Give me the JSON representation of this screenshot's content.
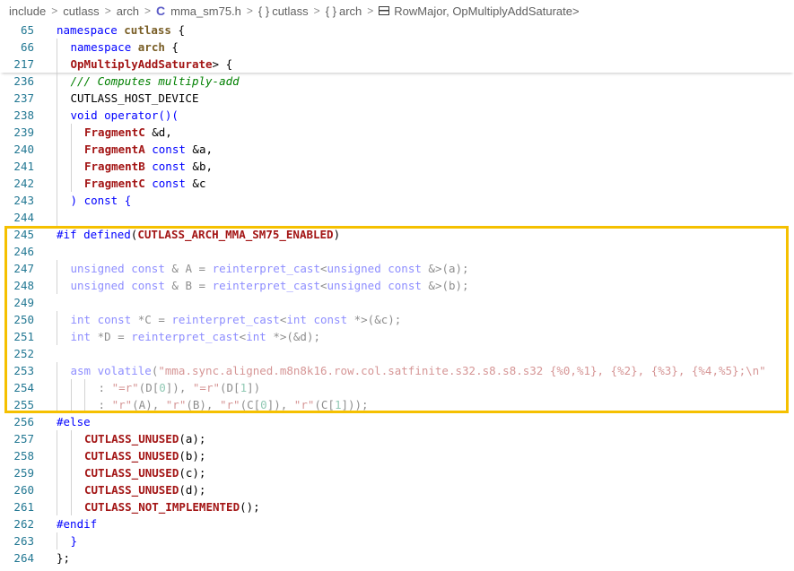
{
  "breadcrumb": {
    "items": [
      "include",
      "cutlass",
      "arch",
      "mma_sm75.h",
      "cutlass",
      "arch",
      "RowMajor, OpMultiplyAddSaturate>"
    ],
    "separator": ">"
  },
  "colors": {
    "highlight_border": "#f5c000",
    "line_number": "#237893",
    "keyword": "#0000ff",
    "macro": "#a31515"
  },
  "sticky_lines": [
    {
      "num": "65",
      "tokens": [
        {
          "t": "namespace ",
          "c": "kw"
        },
        {
          "t": "cutlass",
          "c": "cls"
        },
        {
          "t": " {",
          "c": "plain"
        }
      ],
      "indent": 0
    },
    {
      "num": "66",
      "tokens": [
        {
          "t": "namespace ",
          "c": "kw"
        },
        {
          "t": "arch",
          "c": "cls"
        },
        {
          "t": " {",
          "c": "plain"
        }
      ],
      "indent": 1
    },
    {
      "num": "217",
      "tokens": [
        {
          "t": "OpMultiplyAddSaturate",
          "c": "macro"
        },
        {
          "t": "> {",
          "c": "plain"
        }
      ],
      "indent": 1
    }
  ],
  "lines": [
    {
      "num": "236",
      "indent": 1,
      "tokens": [
        {
          "t": "/// Computes multiply-add",
          "c": "com"
        }
      ]
    },
    {
      "num": "237",
      "indent": 1,
      "tokens": [
        {
          "t": "CUTLASS_HOST_DEVICE",
          "c": "plain"
        }
      ]
    },
    {
      "num": "238",
      "indent": 1,
      "tokens": [
        {
          "t": "void ",
          "c": "kw"
        },
        {
          "t": "operator",
          "c": "kw"
        },
        {
          "t": "()(",
          "c": "kw"
        }
      ]
    },
    {
      "num": "239",
      "indent": 2,
      "tokens": [
        {
          "t": "FragmentC",
          "c": "macro"
        },
        {
          "t": " &d,",
          "c": "plain"
        }
      ]
    },
    {
      "num": "240",
      "indent": 2,
      "tokens": [
        {
          "t": "FragmentA",
          "c": "macro"
        },
        {
          "t": " const",
          "c": "kw"
        },
        {
          "t": " &a,",
          "c": "plain"
        }
      ]
    },
    {
      "num": "241",
      "indent": 2,
      "tokens": [
        {
          "t": "FragmentB",
          "c": "macro"
        },
        {
          "t": " const",
          "c": "kw"
        },
        {
          "t": " &b,",
          "c": "plain"
        }
      ]
    },
    {
      "num": "242",
      "indent": 2,
      "tokens": [
        {
          "t": "FragmentC",
          "c": "macro"
        },
        {
          "t": " const",
          "c": "kw"
        },
        {
          "t": " &c",
          "c": "plain"
        }
      ]
    },
    {
      "num": "243",
      "indent": 1,
      "tokens": [
        {
          "t": ") ",
          "c": "kw"
        },
        {
          "t": "const",
          "c": "kw"
        },
        {
          "t": " {",
          "c": "kw"
        }
      ]
    },
    {
      "num": "244",
      "indent": 1,
      "tokens": []
    },
    {
      "num": "245",
      "indent": 0,
      "tokens": [
        {
          "t": "#if ",
          "c": "pre"
        },
        {
          "t": "defined",
          "c": "pre"
        },
        {
          "t": "(",
          "c": "plain"
        },
        {
          "t": "CUTLASS_ARCH_MMA_SM75_ENABLED",
          "c": "macro"
        },
        {
          "t": ")",
          "c": "plain"
        }
      ]
    },
    {
      "num": "246",
      "indent": 0,
      "tokens": []
    },
    {
      "num": "247",
      "indent": 1,
      "dim": true,
      "tokens": [
        {
          "t": "unsigned ",
          "c": "kw"
        },
        {
          "t": "const",
          "c": "kw"
        },
        {
          "t": " & A = ",
          "c": "plain"
        },
        {
          "t": "reinterpret_cast",
          "c": "kw"
        },
        {
          "t": "<",
          "c": "plain"
        },
        {
          "t": "unsigned ",
          "c": "kw"
        },
        {
          "t": "const",
          "c": "kw"
        },
        {
          "t": " &>(a);",
          "c": "plain"
        }
      ]
    },
    {
      "num": "248",
      "indent": 1,
      "dim": true,
      "tokens": [
        {
          "t": "unsigned ",
          "c": "kw"
        },
        {
          "t": "const",
          "c": "kw"
        },
        {
          "t": " & B = ",
          "c": "plain"
        },
        {
          "t": "reinterpret_cast",
          "c": "kw"
        },
        {
          "t": "<",
          "c": "plain"
        },
        {
          "t": "unsigned ",
          "c": "kw"
        },
        {
          "t": "const",
          "c": "kw"
        },
        {
          "t": " &>(b);",
          "c": "plain"
        }
      ]
    },
    {
      "num": "249",
      "indent": 0,
      "tokens": []
    },
    {
      "num": "250",
      "indent": 1,
      "dim": true,
      "tokens": [
        {
          "t": "int ",
          "c": "kw"
        },
        {
          "t": "const",
          "c": "kw"
        },
        {
          "t": " *C = ",
          "c": "plain"
        },
        {
          "t": "reinterpret_cast",
          "c": "kw"
        },
        {
          "t": "<",
          "c": "plain"
        },
        {
          "t": "int ",
          "c": "kw"
        },
        {
          "t": "const",
          "c": "kw"
        },
        {
          "t": " *>(&c);",
          "c": "plain"
        }
      ]
    },
    {
      "num": "251",
      "indent": 1,
      "dim": true,
      "tokens": [
        {
          "t": "int ",
          "c": "kw"
        },
        {
          "t": "*D = ",
          "c": "plain"
        },
        {
          "t": "reinterpret_cast",
          "c": "kw"
        },
        {
          "t": "<",
          "c": "plain"
        },
        {
          "t": "int ",
          "c": "kw"
        },
        {
          "t": "*>(&d);",
          "c": "plain"
        }
      ]
    },
    {
      "num": "252",
      "indent": 0,
      "tokens": []
    },
    {
      "num": "253",
      "indent": 1,
      "dim": true,
      "tokens": [
        {
          "t": "asm ",
          "c": "kw"
        },
        {
          "t": "volatile",
          "c": "kw"
        },
        {
          "t": "(",
          "c": "plain"
        },
        {
          "t": "\"mma.sync.aligned.m8n8k16.row.col.satfinite.s32.s8.s8.s32 {%0,%1}, {%2}, {%3}, {%4,%5};\\n\"",
          "c": "str"
        }
      ]
    },
    {
      "num": "254",
      "indent": 3,
      "dim": true,
      "tokens": [
        {
          "t": ": ",
          "c": "plain"
        },
        {
          "t": "\"=r\"",
          "c": "str"
        },
        {
          "t": "(D[",
          "c": "plain"
        },
        {
          "t": "0",
          "c": "num"
        },
        {
          "t": "]), ",
          "c": "plain"
        },
        {
          "t": "\"=r\"",
          "c": "str"
        },
        {
          "t": "(D[",
          "c": "plain"
        },
        {
          "t": "1",
          "c": "num"
        },
        {
          "t": "])",
          "c": "plain"
        }
      ]
    },
    {
      "num": "255",
      "indent": 3,
      "dim": true,
      "tokens": [
        {
          "t": ": ",
          "c": "plain"
        },
        {
          "t": "\"r\"",
          "c": "str"
        },
        {
          "t": "(A), ",
          "c": "plain"
        },
        {
          "t": "\"r\"",
          "c": "str"
        },
        {
          "t": "(B), ",
          "c": "plain"
        },
        {
          "t": "\"r\"",
          "c": "str"
        },
        {
          "t": "(C[",
          "c": "plain"
        },
        {
          "t": "0",
          "c": "num"
        },
        {
          "t": "]), ",
          "c": "plain"
        },
        {
          "t": "\"r\"",
          "c": "str"
        },
        {
          "t": "(C[",
          "c": "plain"
        },
        {
          "t": "1",
          "c": "num"
        },
        {
          "t": "]));",
          "c": "plain"
        }
      ]
    },
    {
      "num": "256",
      "indent": 0,
      "tokens": [
        {
          "t": "#else",
          "c": "pre"
        }
      ]
    },
    {
      "num": "257",
      "indent": 2,
      "tokens": [
        {
          "t": "CUTLASS_UNUSED",
          "c": "macro"
        },
        {
          "t": "(a);",
          "c": "plain"
        }
      ]
    },
    {
      "num": "258",
      "indent": 2,
      "tokens": [
        {
          "t": "CUTLASS_UNUSED",
          "c": "macro"
        },
        {
          "t": "(b);",
          "c": "plain"
        }
      ]
    },
    {
      "num": "259",
      "indent": 2,
      "tokens": [
        {
          "t": "CUTLASS_UNUSED",
          "c": "macro"
        },
        {
          "t": "(c);",
          "c": "plain"
        }
      ]
    },
    {
      "num": "260",
      "indent": 2,
      "tokens": [
        {
          "t": "CUTLASS_UNUSED",
          "c": "macro"
        },
        {
          "t": "(d);",
          "c": "plain"
        }
      ]
    },
    {
      "num": "261",
      "indent": 2,
      "tokens": [
        {
          "t": "CUTLASS_NOT_IMPLEMENTED",
          "c": "macro"
        },
        {
          "t": "();",
          "c": "plain"
        }
      ]
    },
    {
      "num": "262",
      "indent": 0,
      "tokens": [
        {
          "t": "#endif",
          "c": "pre"
        }
      ]
    },
    {
      "num": "263",
      "indent": 1,
      "tokens": [
        {
          "t": "}",
          "c": "kw"
        }
      ]
    },
    {
      "num": "264",
      "indent": 0,
      "tokens": [
        {
          "t": "};",
          "c": "plain"
        }
      ]
    }
  ]
}
